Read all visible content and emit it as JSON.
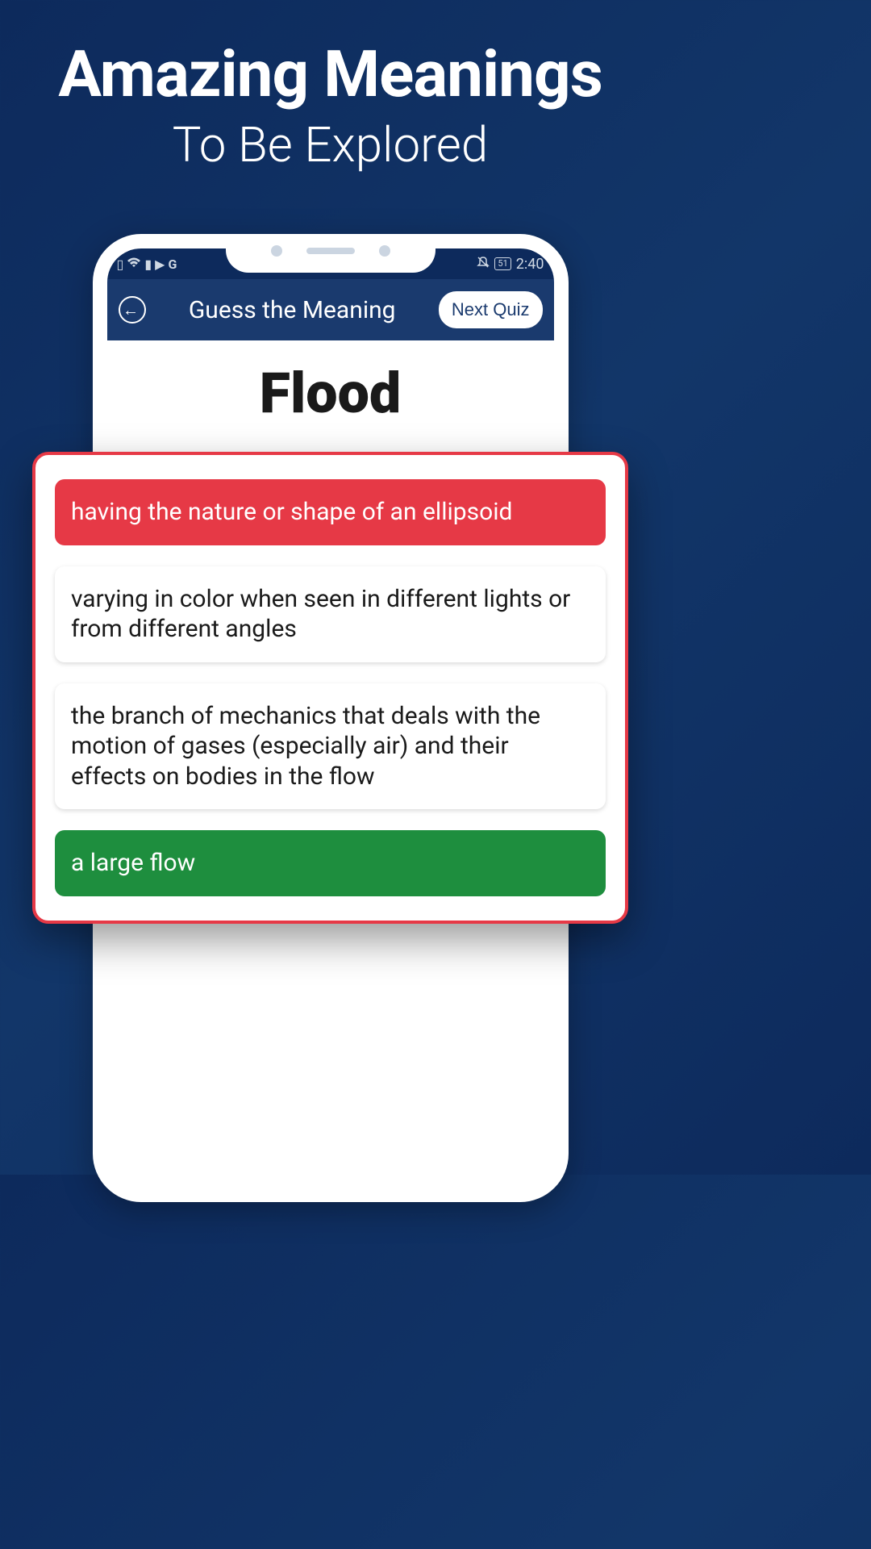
{
  "promo": {
    "title": "Amazing Meanings",
    "subtitle": "To Be Explored"
  },
  "statusBar": {
    "batteryLevel": "51",
    "time": "2:40"
  },
  "app": {
    "headerTitle": "Guess the Meaning",
    "nextQuizLabel": "Next Quiz",
    "word": "Flood",
    "options": [
      {
        "text": "having the nature or shape of an ellipsoid",
        "state": "wrong"
      },
      {
        "text": "varying in color when seen in different lights or from different angles",
        "state": "neutral"
      },
      {
        "text": "the branch of mechanics that deals with the motion of gases (especially air) and their effects on bodies in the flow",
        "state": "neutral"
      },
      {
        "text": "a large flow",
        "state": "correct"
      }
    ]
  }
}
